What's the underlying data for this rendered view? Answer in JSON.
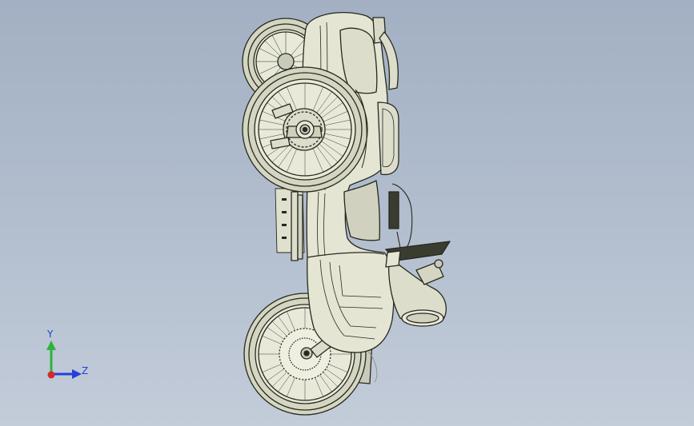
{
  "viewport": {
    "background_top": "#a3b0c3",
    "background_bottom": "#c3ccd9"
  },
  "model": {
    "name": "sidecar-motorcycle",
    "line_color": "#26291f",
    "body_color": "#e4e5d3",
    "shade_color": "#b9bba6",
    "tire_color": "#d4d6c1"
  },
  "triad": {
    "y_label": "Y",
    "z_label": "Z",
    "y_color": "#2bb33d",
    "z_color": "#2340d8",
    "x_color": "#d42a2a",
    "label_color": "#2340d8"
  }
}
